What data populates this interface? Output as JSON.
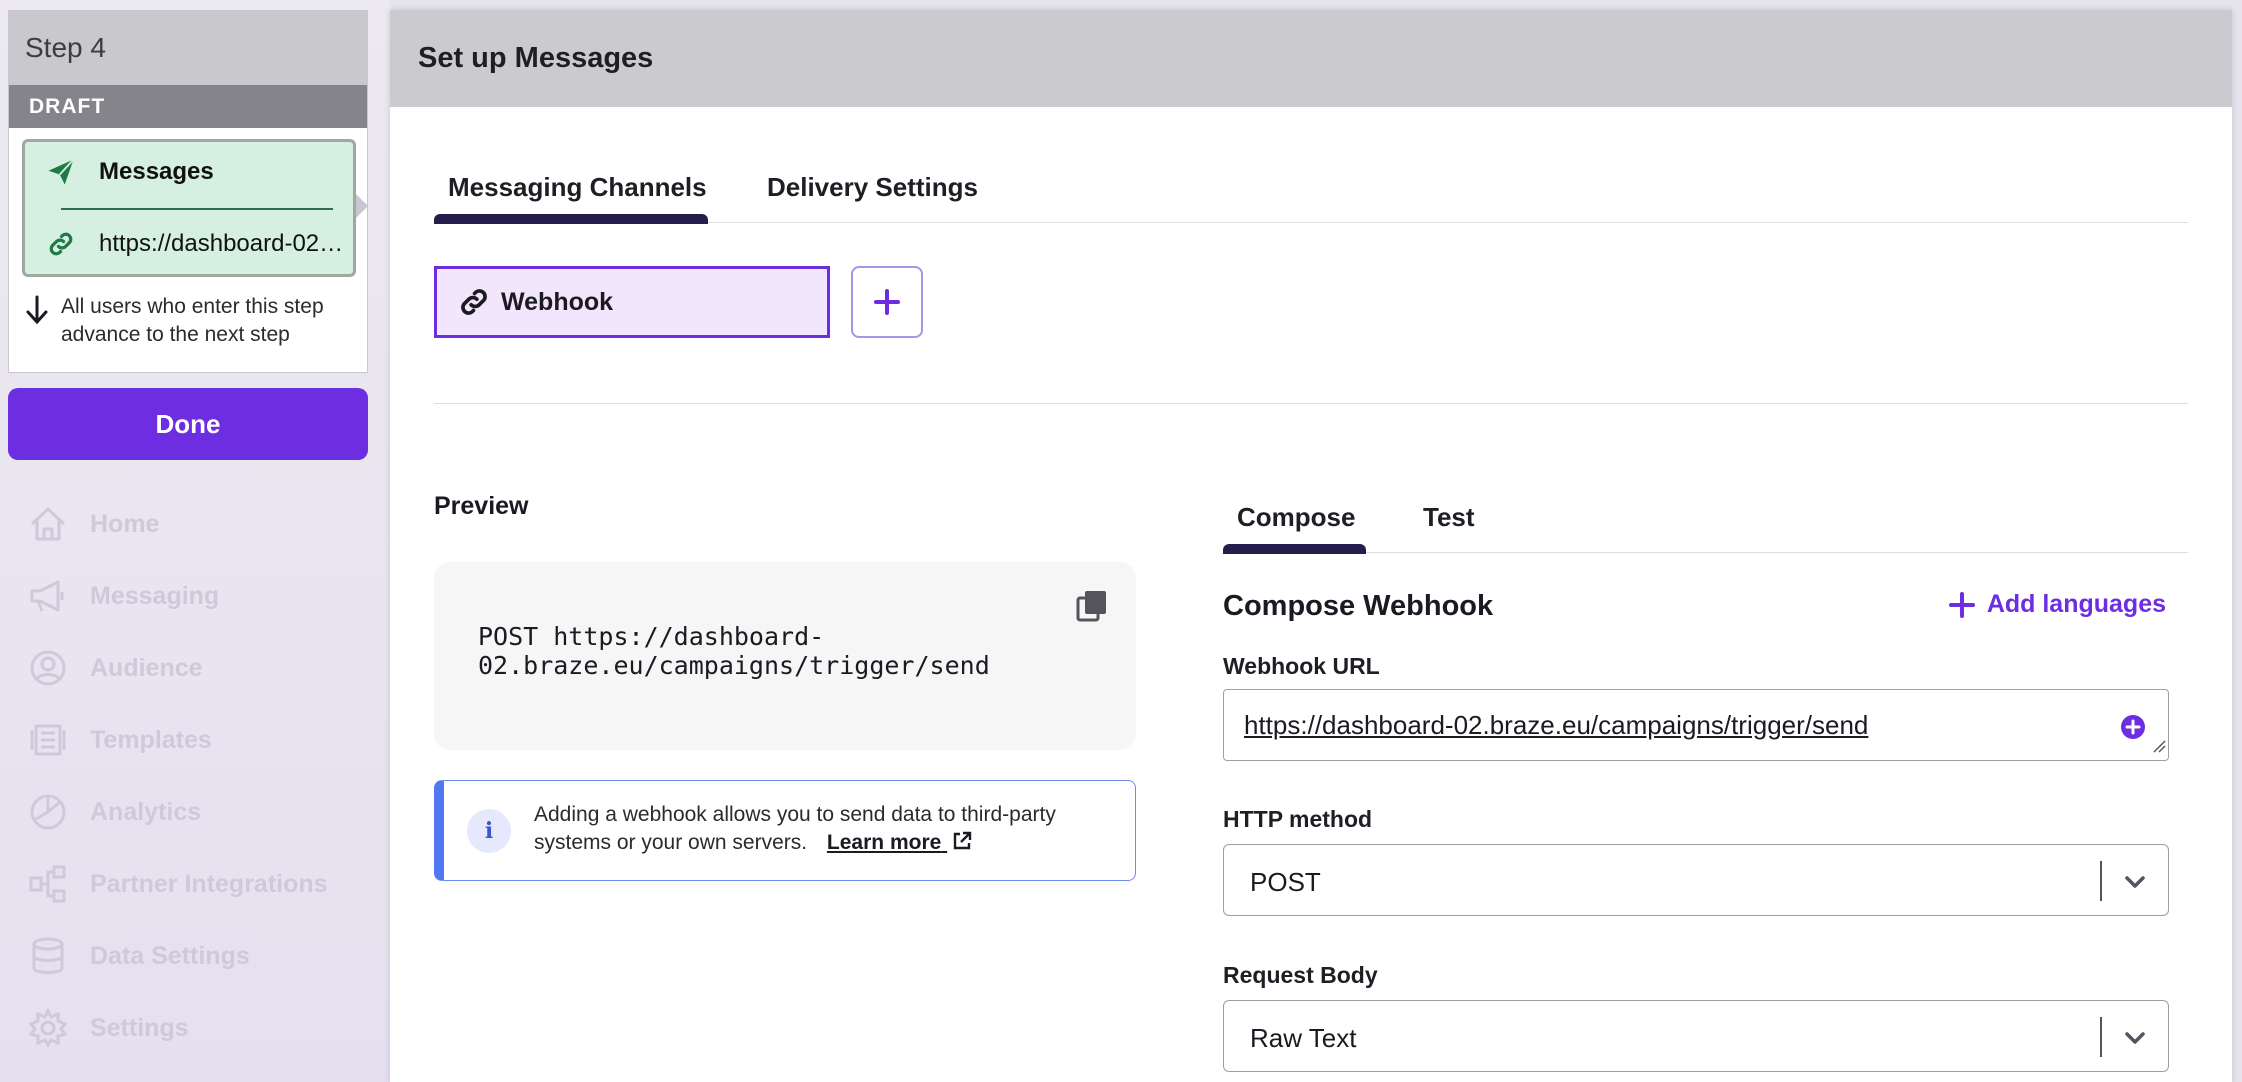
{
  "step": {
    "title": "Step 4",
    "status": "DRAFT",
    "messages_label": "Messages",
    "webhook_url_short": "https://dashboard-02.braze.eu/campaigns/trigger/send",
    "advance_text": "All users who enter this step advance to the next step"
  },
  "done_label": "Done",
  "nav": {
    "items": [
      {
        "label": "Home",
        "icon": "home-icon"
      },
      {
        "label": "Messaging",
        "icon": "megaphone-icon"
      },
      {
        "label": "Audience",
        "icon": "user-circle-icon"
      },
      {
        "label": "Templates",
        "icon": "templates-icon"
      },
      {
        "label": "Analytics",
        "icon": "pie-chart-icon"
      },
      {
        "label": "Partner Integrations",
        "icon": "integrations-icon"
      },
      {
        "label": "Data Settings",
        "icon": "database-icon"
      },
      {
        "label": "Settings",
        "icon": "gear-icon"
      }
    ]
  },
  "panel": {
    "title": "Set up Messages",
    "tabs": [
      "Messaging Channels",
      "Delivery Settings"
    ],
    "active_tab": "Messaging Channels",
    "channel": "Webhook"
  },
  "preview": {
    "title": "Preview",
    "code_line1": "POST https://dashboard-",
    "code_line2": "02.braze.eu/campaigns/trigger/send",
    "info_text": "Adding a webhook allows you to send data to third-party systems or your own servers.",
    "learn_more": "Learn more"
  },
  "compose": {
    "tabs": [
      "Compose",
      "Test"
    ],
    "active_tab": "Compose",
    "title": "Compose Webhook",
    "add_languages": "Add languages",
    "webhook_url_label": "Webhook URL",
    "webhook_url_value": "https://dashboard-02.braze.eu/campaigns/trigger/send",
    "http_method_label": "HTTP method",
    "http_method_value": "POST",
    "request_body_label": "Request Body",
    "request_body_value": "Raw Text"
  },
  "colors": {
    "accent": "#6c2ee0",
    "tab_indicator": "#231f4a",
    "step_body_bg": "#d5efe1",
    "step_icon": "#1f7a45",
    "info_border": "#5177f1"
  }
}
